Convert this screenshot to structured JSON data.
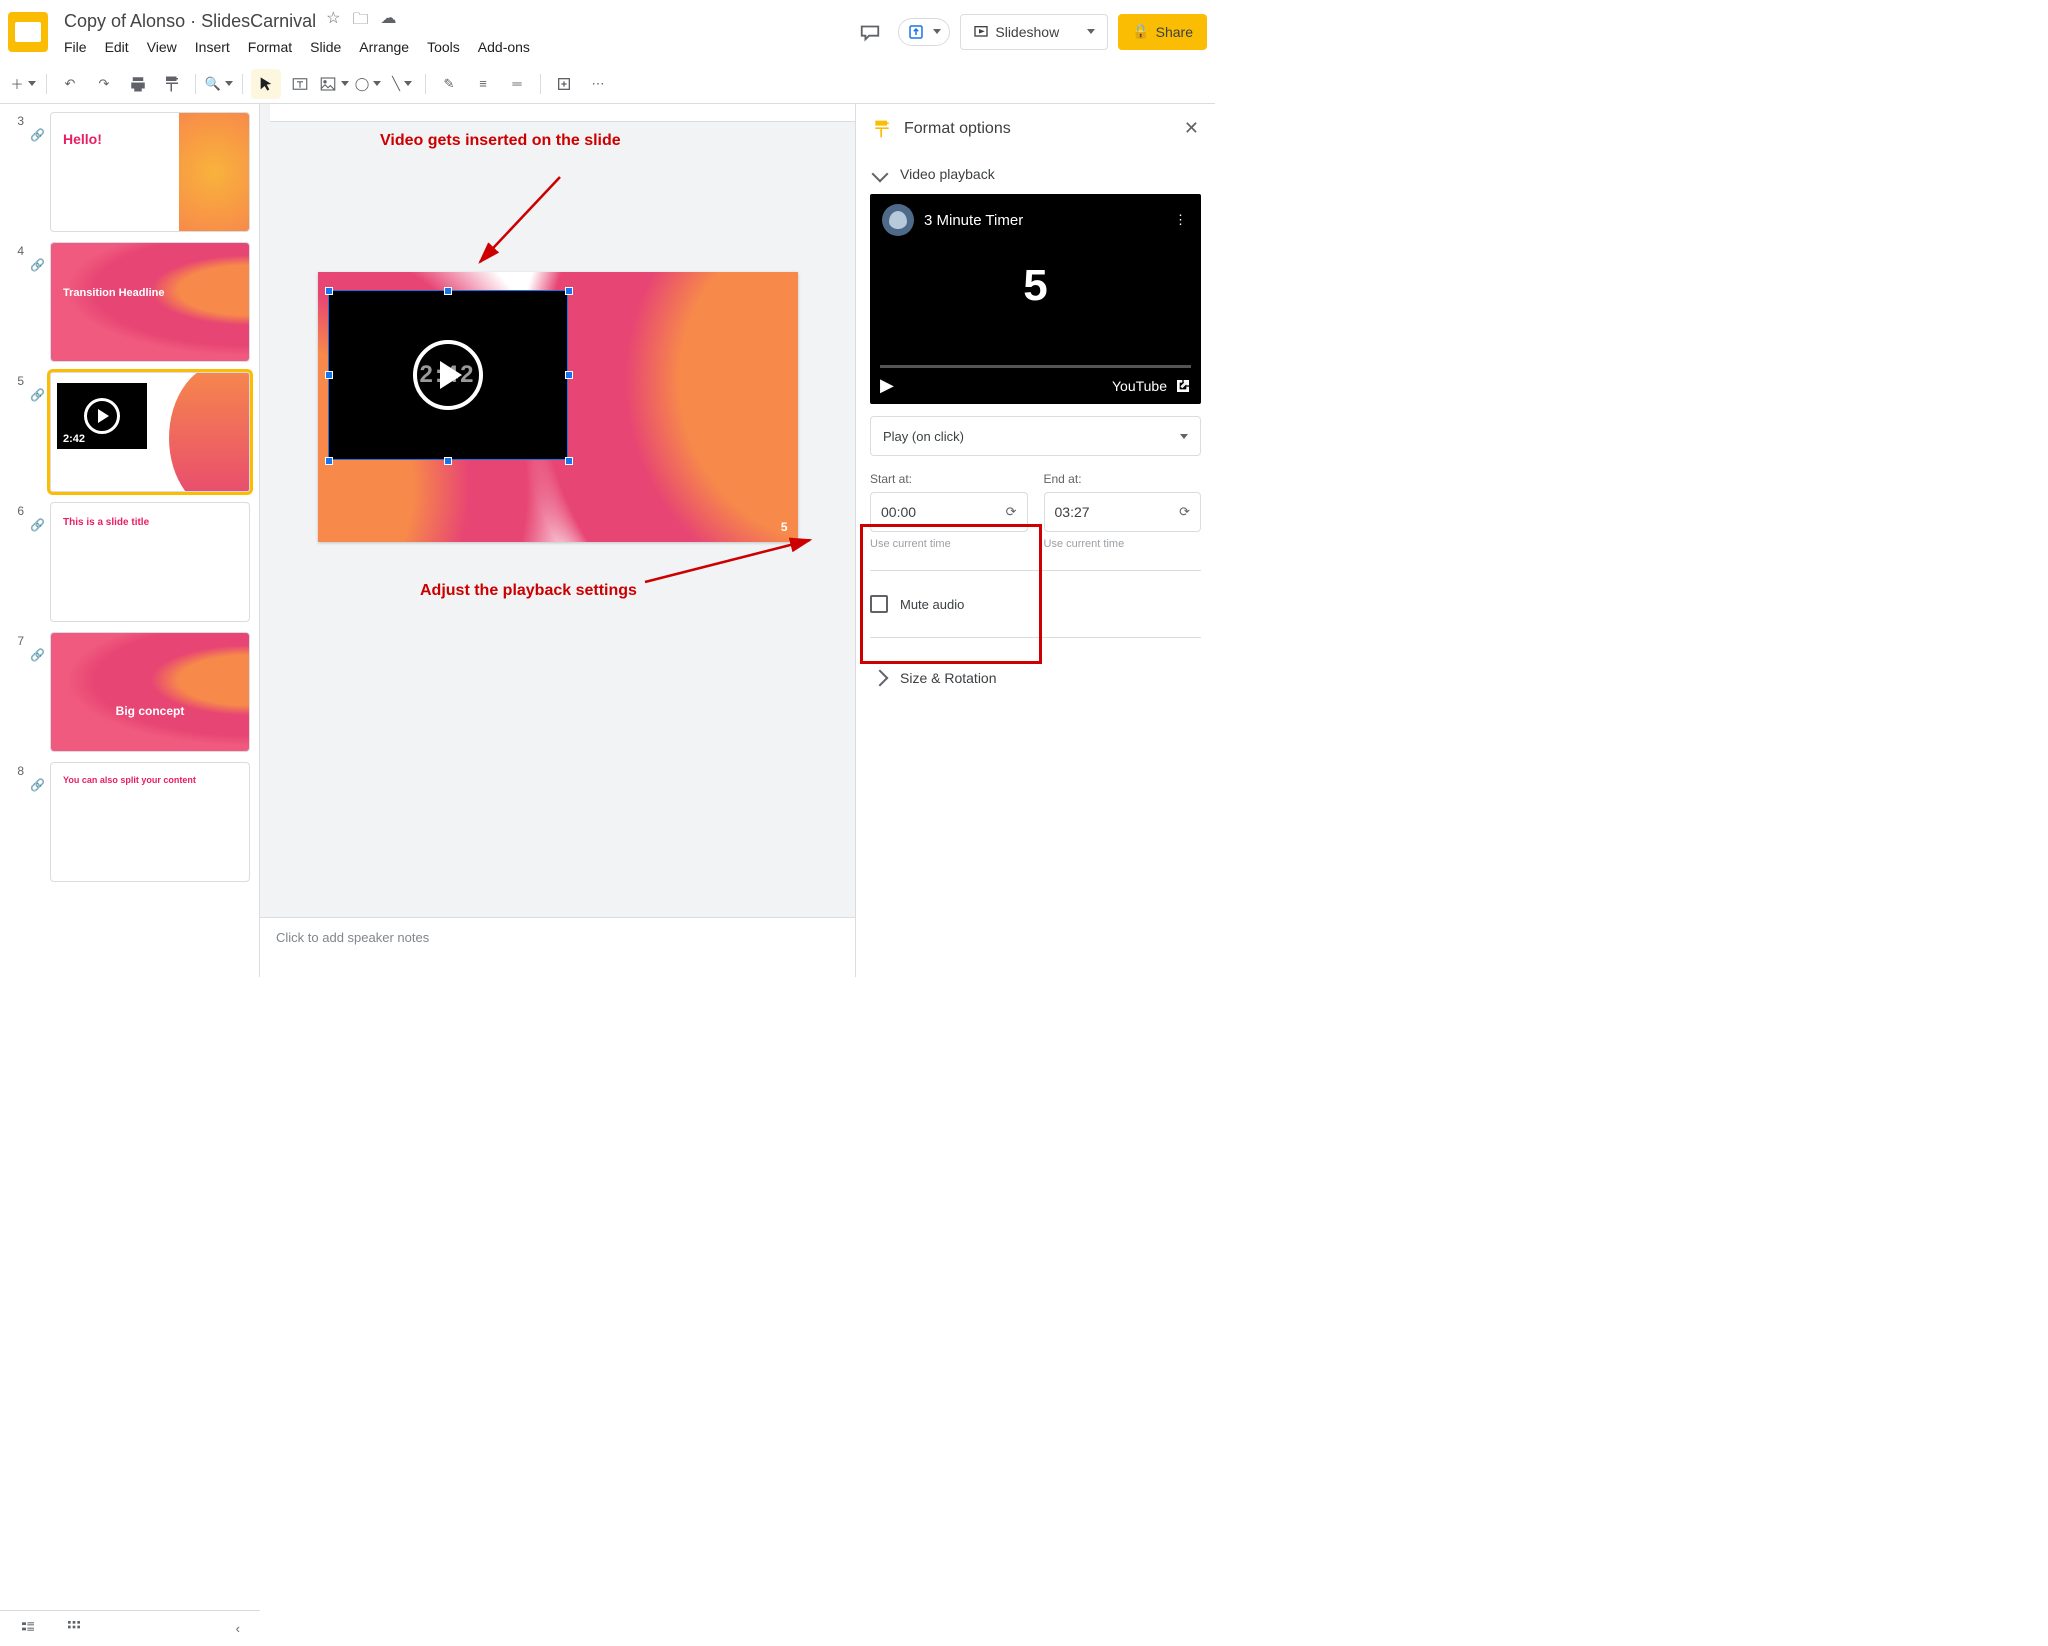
{
  "header": {
    "doc_title": "Copy of Alonso · SlidesCarnival",
    "menus": [
      "File",
      "Edit",
      "View",
      "Insert",
      "Format",
      "Slide",
      "Arrange",
      "Tools",
      "Add-ons"
    ],
    "slideshow_label": "Slideshow",
    "share_label": "Share"
  },
  "thumbnails": [
    {
      "num": "3",
      "title": "Hello!"
    },
    {
      "num": "4",
      "title": "Transition Headline"
    },
    {
      "num": "5",
      "title": ""
    },
    {
      "num": "6",
      "title": "This is a slide title"
    },
    {
      "num": "7",
      "title": "Big concept"
    },
    {
      "num": "8",
      "title": "You can also split your content"
    }
  ],
  "canvas": {
    "video_time_overlay": "2:42",
    "slide_page_num": "5",
    "annotation_top": "Video gets inserted on the slide",
    "annotation_bottom": "Adjust the playback settings"
  },
  "notes_placeholder": "Click to add speaker notes",
  "panel": {
    "title": "Format options",
    "section_playback": "Video playback",
    "yt_title": "3 Minute Timer",
    "yt_counter": "5",
    "yt_brand": "YouTube",
    "play_mode": "Play (on click)",
    "start_label": "Start at:",
    "end_label": "End at:",
    "start_value": "00:00",
    "end_value": "03:27",
    "current_time_hint": "Use current time",
    "mute_label": "Mute audio",
    "section_size": "Size & Rotation"
  }
}
